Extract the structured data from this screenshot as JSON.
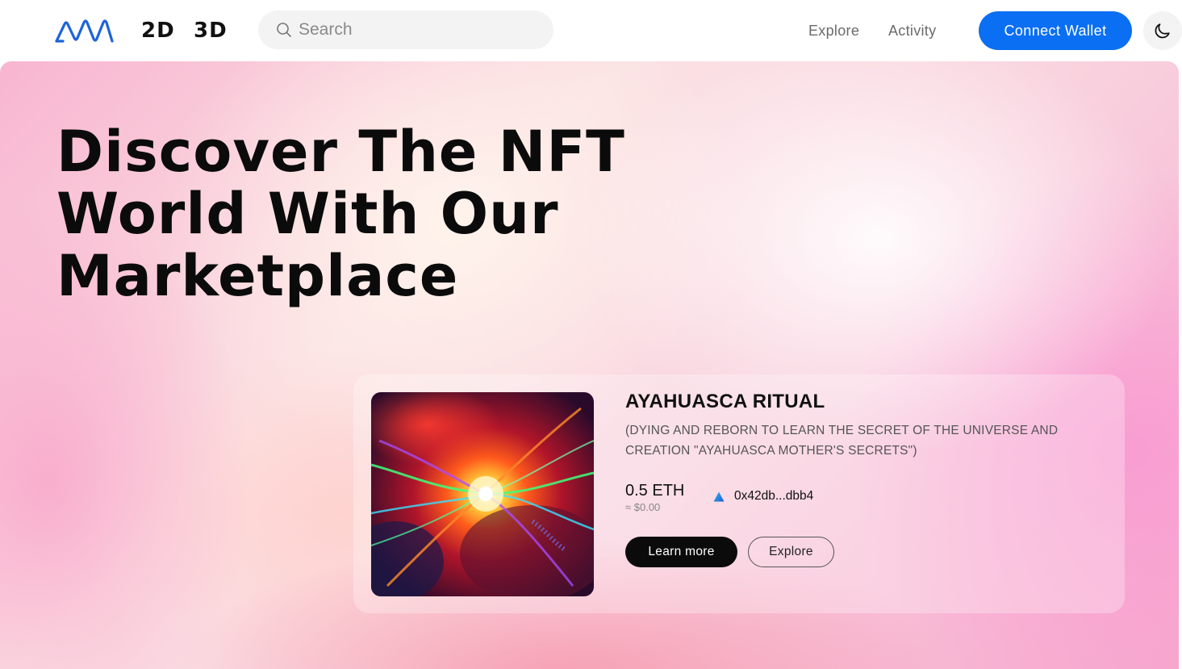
{
  "header": {
    "logo_icon": "marketplace-logo-icon",
    "modes": [
      "2D",
      "3D"
    ],
    "search": {
      "placeholder": "Search",
      "icon": "search-icon"
    },
    "nav": {
      "explore": "Explore",
      "activity": "Activity"
    },
    "connect_wallet": "Connect Wallet",
    "theme_icon": "moon-icon",
    "accent_color": "#0a6ff2"
  },
  "hero": {
    "title_lines": [
      "Discover The NFT",
      "World With Our",
      "Marketplace"
    ]
  },
  "featured": {
    "title": "AYAHUASCA RITUAL",
    "description": "(DYING AND REBORN TO LEARN THE SECRET OF THE UNIVERSE AND CREATION \"AYAHUASCA MOTHER'S SECRETS\")",
    "price": "0.5 ETH",
    "price_usd": "≈ $0.00",
    "owner_icon": "chain-triangle-icon",
    "owner_address": "0x42db...dbb4",
    "learn_more": "Learn more",
    "explore": "Explore",
    "image_icon": "nft-artwork"
  }
}
